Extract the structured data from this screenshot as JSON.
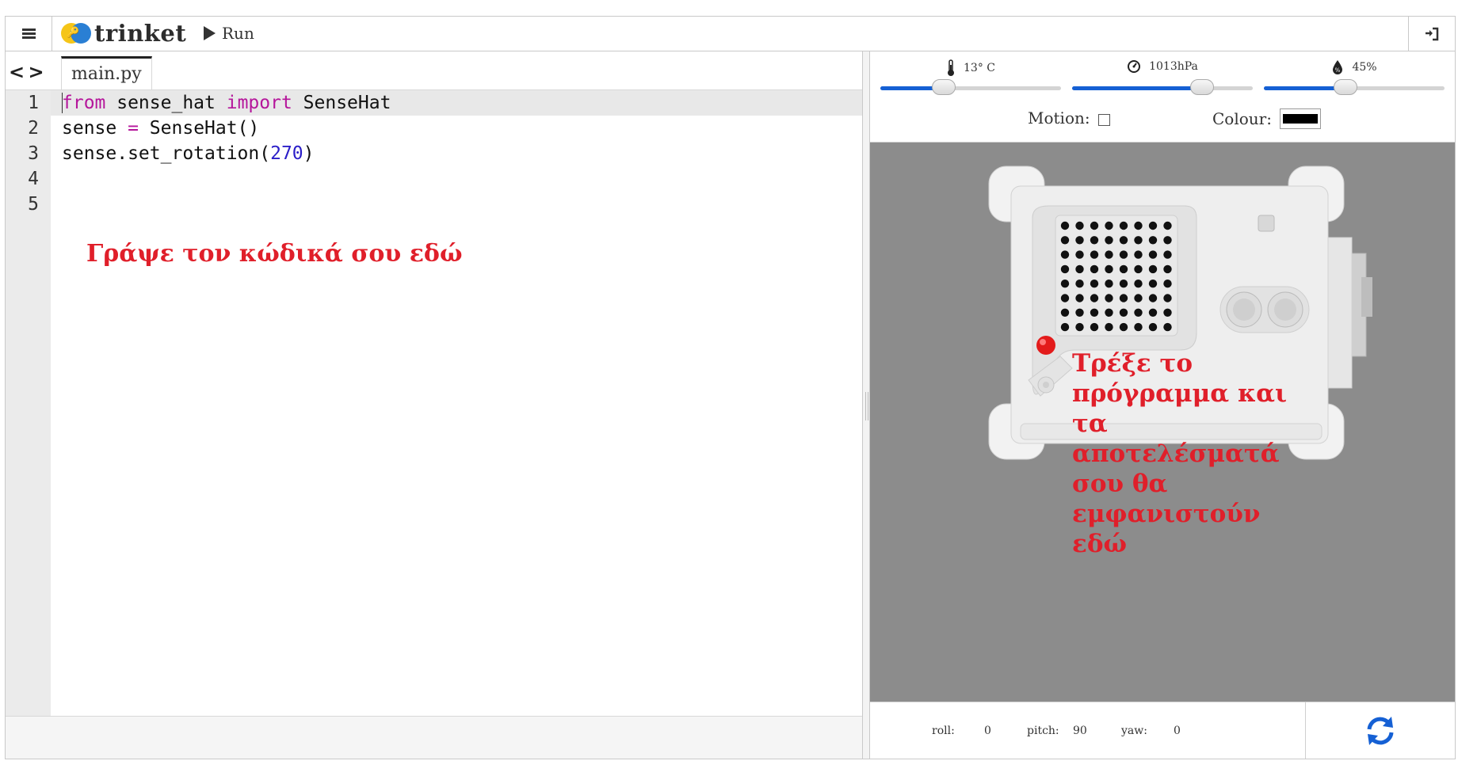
{
  "app": {
    "brand": "trinket"
  },
  "toolbar": {
    "run_label": "Run",
    "menu_icon": "hamburger-menu-icon",
    "login_icon": "sign-in-icon"
  },
  "editor": {
    "file_tab": "main.py",
    "line_numbers": [
      "1",
      "2",
      "3",
      "4",
      "5"
    ],
    "code_lines": [
      "from sense_hat import SenseHat",
      "sense = SenseHat()",
      "sense.set_rotation(270)",
      "",
      ""
    ],
    "hint": "Γράψε τον κώδικά σου εδώ"
  },
  "sense_hat": {
    "temperature_label": "13° C",
    "temperature_level": 0.35,
    "pressure_label": "1013hPa",
    "pressure_level": 0.72,
    "humidity_label": "45%",
    "humidity_level": 0.45,
    "motion_label": "Motion:",
    "motion_checked": false,
    "colour_label": "Colour:",
    "colour_value": "#000000",
    "output_hint": "Τρέξε το πρόγραμμα και τα αποτελέσματά σου θα εμφανιστούν εδώ"
  },
  "orientation": {
    "roll_label": "roll:",
    "roll_value": "0",
    "pitch_label": "pitch:",
    "pitch_value": "90",
    "yaw_label": "yaw:",
    "yaw_value": "0"
  },
  "colors": {
    "accent": "#1560d4",
    "hint": "#e01f2a",
    "viewport": "#8c8c8c",
    "keyword": "#b5169b",
    "number": "#2b1ec8"
  }
}
